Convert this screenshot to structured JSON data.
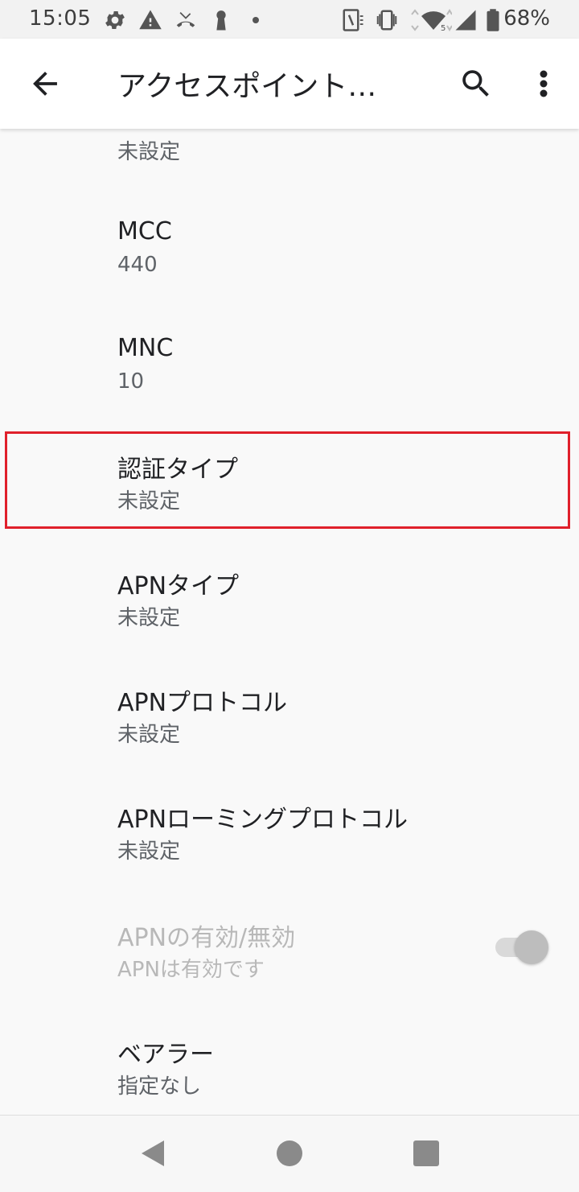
{
  "status_bar": {
    "time": "15:05",
    "battery_percent": "68%",
    "icons": [
      "gear-icon",
      "warning-icon",
      "missed-call-icon",
      "keyhole-icon",
      "dot-icon",
      "nfc-icon",
      "vibrate-icon",
      "wifi-icon",
      "signal-icon",
      "battery-icon"
    ]
  },
  "app_bar": {
    "title": "アクセスポイント…",
    "back_icon": "arrow-back-icon",
    "search_icon": "search-icon",
    "more_icon": "more-vert-icon"
  },
  "list": {
    "partial_item": {
      "subtitle": "未設定"
    },
    "items": [
      {
        "title": "MCC",
        "subtitle": "440"
      },
      {
        "title": "MNC",
        "subtitle": "10"
      },
      {
        "title": "認証タイプ",
        "subtitle": "未設定"
      },
      {
        "title": "APNタイプ",
        "subtitle": "未設定"
      },
      {
        "title": "APNプロトコル",
        "subtitle": "未設定"
      },
      {
        "title": "APNローミングプロトコル",
        "subtitle": "未設定"
      },
      {
        "title": "APNの有効/無効",
        "subtitle": "APNは有効です",
        "toggle_on": true,
        "disabled": true
      },
      {
        "title": "ベアラー",
        "subtitle": "指定なし"
      }
    ]
  },
  "colors": {
    "highlight": "#e0202b",
    "background": "#f9f9f9"
  }
}
